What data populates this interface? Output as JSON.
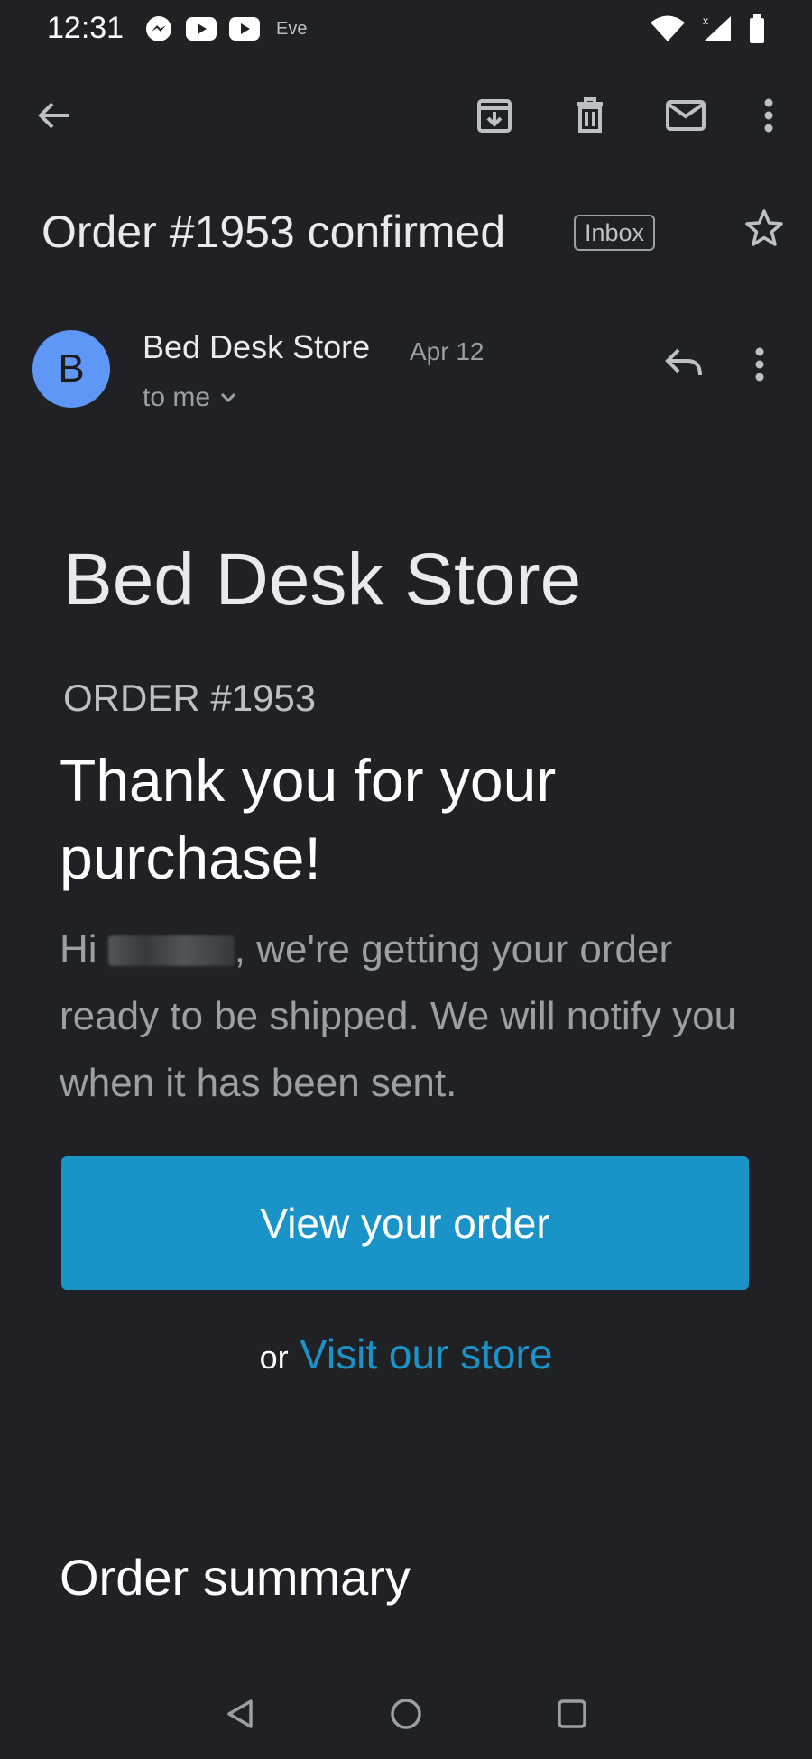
{
  "status_bar": {
    "time": "12:31",
    "left_icons": [
      "messenger-icon",
      "youtube-icon",
      "youtube-icon"
    ],
    "carrier_text": "Eve",
    "right_icons": [
      "wifi-icon",
      "signal-icon",
      "battery-icon"
    ]
  },
  "toolbar": {
    "icons": [
      "back-arrow-icon",
      "archive-icon",
      "delete-icon",
      "mark-unread-icon",
      "more-vert-icon"
    ]
  },
  "email": {
    "subject": "Order #1953 confirmed",
    "label": "Inbox",
    "starred": false,
    "sender": {
      "avatar_letter": "B",
      "avatar_color": "#5e97f6",
      "name": "Bed Desk Store",
      "date": "Apr 12",
      "recipient": "to me"
    }
  },
  "body": {
    "store_title": "Bed Desk Store",
    "order_number": "ORDER #1953",
    "heading": "Thank you for your purchase!",
    "greeting": "Hi",
    "message": ", we're getting your order ready to be shipped. We will notify you when it has been sent.",
    "cta_label": "View your order",
    "or_text": "or",
    "store_link": "Visit our store",
    "section_title": "Order summary"
  },
  "nav_bar": {
    "icons": [
      "nav-back-icon",
      "nav-home-icon",
      "nav-recents-icon"
    ]
  },
  "colors": {
    "background": "#202124",
    "accent": "#1a93c8",
    "text_primary": "#e8eaed",
    "text_secondary": "#9aa0a6"
  }
}
